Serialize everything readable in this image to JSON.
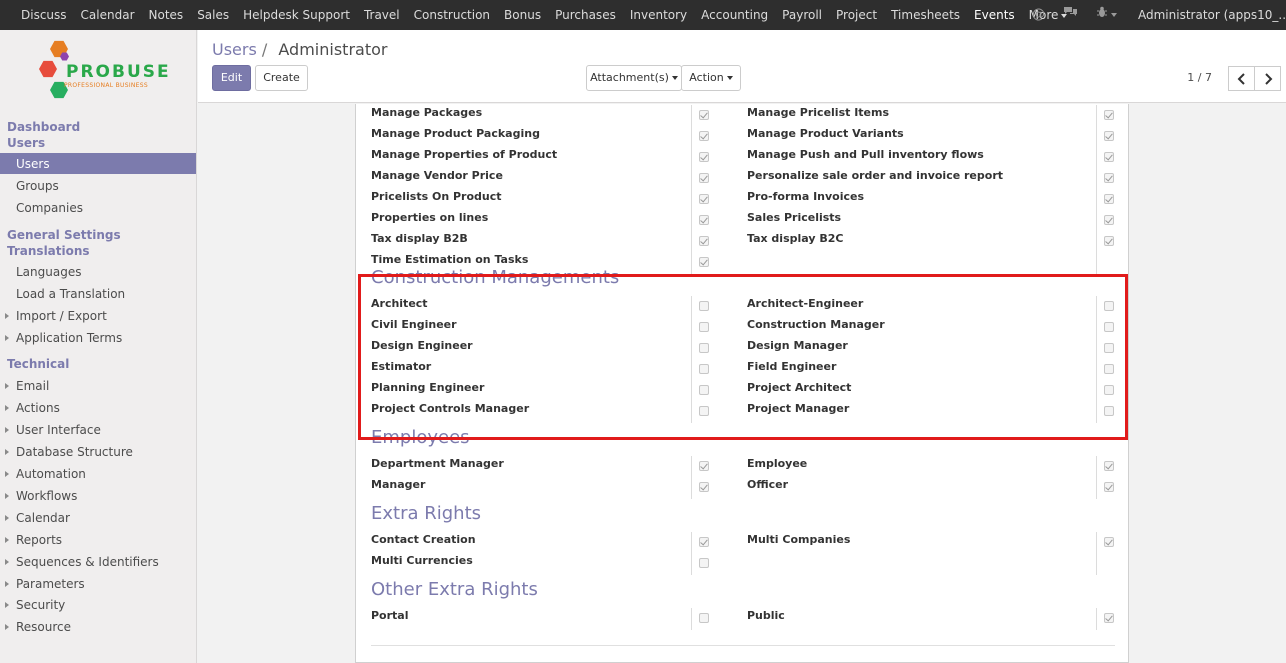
{
  "topmenu": {
    "items": [
      "Discuss",
      "Calendar",
      "Notes",
      "Sales",
      "Helpdesk Support",
      "Travel",
      "Construction",
      "Bonus",
      "Purchases",
      "Inventory",
      "Accounting",
      "Payroll",
      "Project",
      "Timesheets",
      "Events"
    ],
    "active": "Events",
    "more_label": "More",
    "user_label": "Administrator (apps10_..."
  },
  "logo": {
    "text": "PROBUSE",
    "sub": "PROFESSIONAL BUSINESS"
  },
  "sidebar": {
    "dashboard": "Dashboard",
    "users_head": "Users",
    "users": "Users",
    "groups": "Groups",
    "companies": "Companies",
    "general_settings": "General Settings",
    "translations": "Translations",
    "languages": "Languages",
    "load_translation": "Load a Translation",
    "import_export": "Import / Export",
    "application_terms": "Application Terms",
    "technical": "Technical",
    "technical_items": [
      "Email",
      "Actions",
      "User Interface",
      "Database Structure",
      "Automation",
      "Workflows",
      "Calendar",
      "Reports",
      "Sequences & Identifiers",
      "Parameters",
      "Security",
      "Resource"
    ]
  },
  "control_panel": {
    "breadcrumb_parent": "Users",
    "breadcrumb_sep": "/",
    "breadcrumb_current": "Administrator",
    "edit": "Edit",
    "create": "Create",
    "attachments": "Attachment(s)",
    "action": "Action",
    "pager": "1 / 7"
  },
  "form": {
    "top_rows": [
      {
        "left": "Manage Packages",
        "left_checked": true,
        "right": "Manage Pricelist Items",
        "right_checked": true
      },
      {
        "left": "Manage Product Packaging",
        "left_checked": true,
        "right": "Manage Product Variants",
        "right_checked": true
      },
      {
        "left": "Manage Properties of Product",
        "left_checked": true,
        "right": "Manage Push and Pull inventory flows",
        "right_checked": true
      },
      {
        "left": "Manage Vendor Price",
        "left_checked": true,
        "right": "Personalize sale order and invoice report",
        "right_checked": true
      },
      {
        "left": "Pricelists On Product",
        "left_checked": true,
        "right": "Pro-forma Invoices",
        "right_checked": true
      },
      {
        "left": "Properties on lines",
        "left_checked": true,
        "right": "Sales Pricelists",
        "right_checked": true
      },
      {
        "left": "Tax display B2B",
        "left_checked": true,
        "right": "Tax display B2C",
        "right_checked": true
      },
      {
        "left": "Time Estimation on Tasks",
        "left_checked": true,
        "right": "",
        "right_checked": null
      }
    ],
    "construction": {
      "title": "Construction Managements",
      "rows": [
        {
          "left": "Architect",
          "left_checked": false,
          "right": "Architect-Engineer",
          "right_checked": false
        },
        {
          "left": "Civil Engineer",
          "left_checked": false,
          "right": "Construction Manager",
          "right_checked": false
        },
        {
          "left": "Design Engineer",
          "left_checked": false,
          "right": "Design Manager",
          "right_checked": false
        },
        {
          "left": "Estimator",
          "left_checked": false,
          "right": "Field Engineer",
          "right_checked": false
        },
        {
          "left": "Planning Engineer",
          "left_checked": false,
          "right": "Project Architect",
          "right_checked": false
        },
        {
          "left": "Project Controls Manager",
          "left_checked": false,
          "right": "Project Manager",
          "right_checked": false
        }
      ]
    },
    "employees": {
      "title": "Employees",
      "rows": [
        {
          "left": "Department Manager",
          "left_checked": true,
          "right": "Employee",
          "right_checked": true
        },
        {
          "left": "Manager",
          "left_checked": true,
          "right": "Officer",
          "right_checked": true
        }
      ]
    },
    "extra_rights": {
      "title": "Extra Rights",
      "rows": [
        {
          "left": "Contact Creation",
          "left_checked": true,
          "right": "Multi Companies",
          "right_checked": true
        },
        {
          "left": "Multi Currencies",
          "left_checked": false,
          "right": "",
          "right_checked": null
        }
      ]
    },
    "other_extra_rights": {
      "title": "Other Extra Rights",
      "rows": [
        {
          "left": "Portal",
          "left_checked": false,
          "right": "Public",
          "right_checked": true
        }
      ]
    }
  },
  "colors": {
    "accent": "#7c7bad",
    "highlight": "#e11b1b",
    "topbar": "#2e2e2e"
  }
}
